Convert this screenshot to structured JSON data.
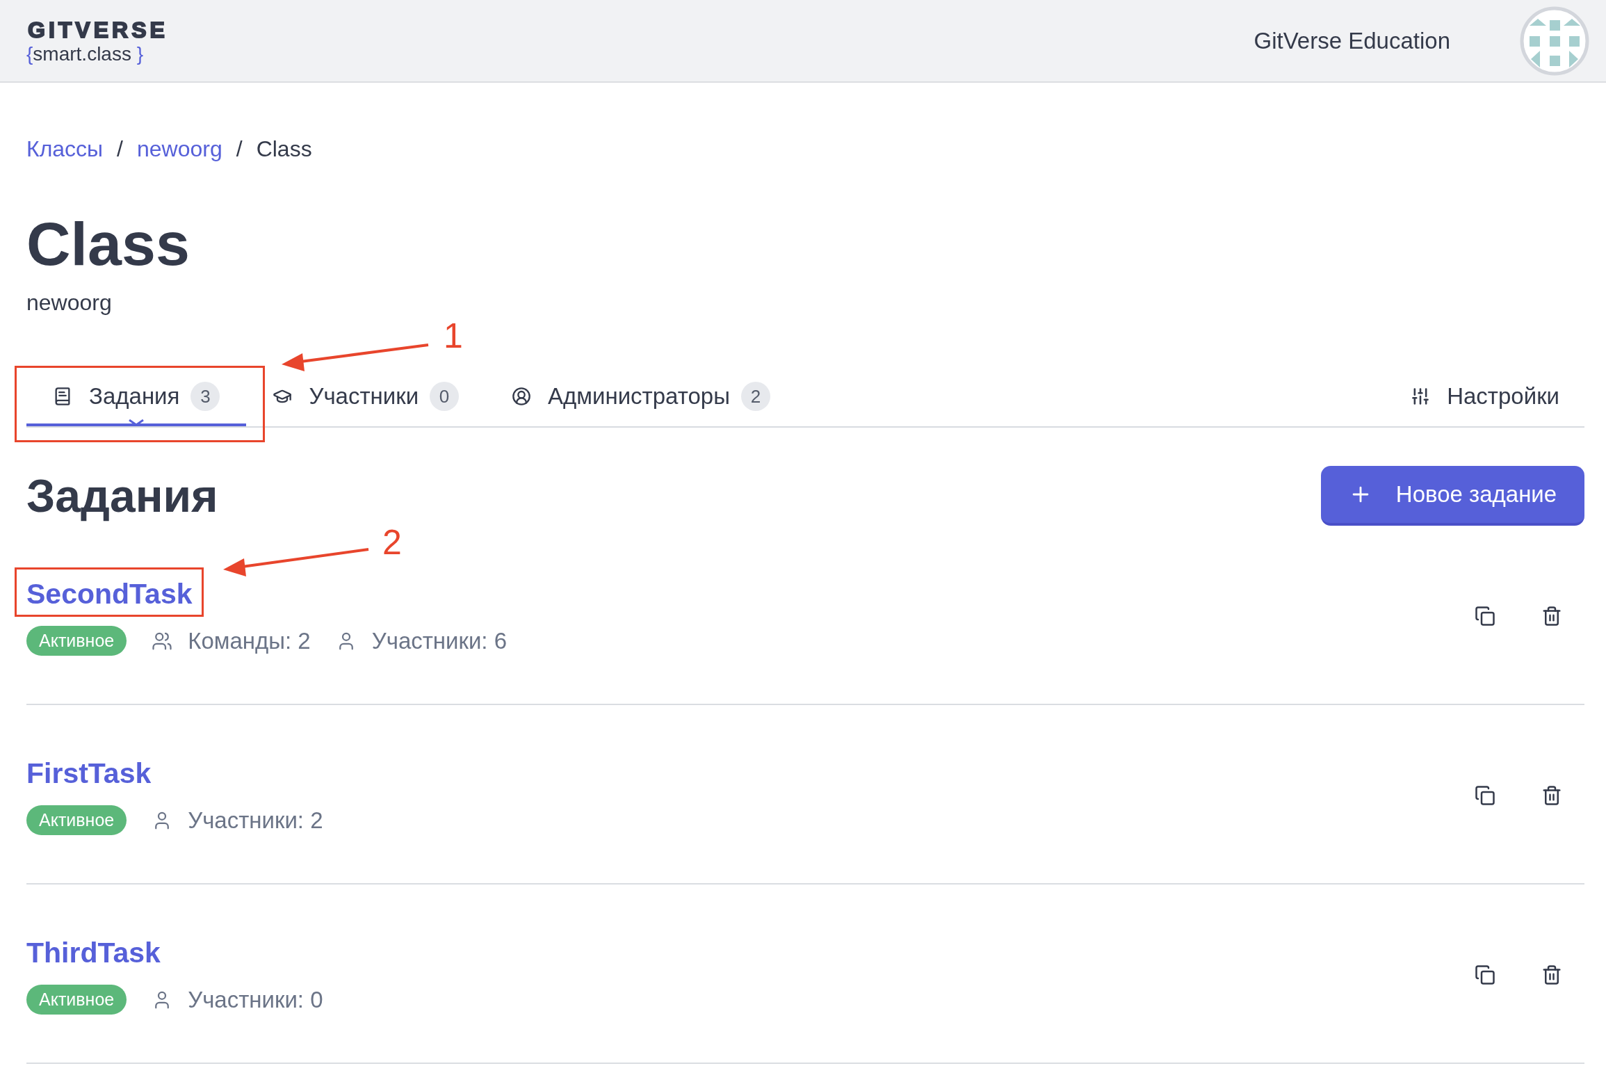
{
  "header": {
    "logo": {
      "wordmark": "GITVERSE",
      "brace_open": "{",
      "tagline": "smart.class",
      "brace_close": "}"
    },
    "org_name": "GitVerse Education"
  },
  "breadcrumbs": [
    {
      "label": "Классы",
      "link": true
    },
    {
      "label": "newoorg",
      "link": true
    },
    {
      "label": "Class",
      "link": false
    }
  ],
  "breadcrumb_separator": "/",
  "page": {
    "title": "Class",
    "subtitle": "newoorg"
  },
  "tabs": [
    {
      "kind": "tasks",
      "label": "Задания",
      "count": "3",
      "selected": true
    },
    {
      "kind": "members",
      "label": "Участники",
      "count": "0",
      "selected": false
    },
    {
      "kind": "admins",
      "label": "Администраторы",
      "count": "2",
      "selected": false
    }
  ],
  "settings_tab": {
    "label": "Настройки",
    "selected": false
  },
  "section": {
    "title": "Задания",
    "new_button": "Новое задание"
  },
  "tasks": [
    {
      "title": "SecondTask",
      "status": "Активное",
      "meta": [
        {
          "kind": "teams",
          "text": "Команды: 2"
        },
        {
          "kind": "members",
          "text": "Участники: 6"
        }
      ]
    },
    {
      "title": "FirstTask",
      "status": "Активное",
      "meta": [
        {
          "kind": "members",
          "text": "Участники: 2"
        }
      ]
    },
    {
      "title": "ThirdTask",
      "status": "Активное",
      "meta": [
        {
          "kind": "members",
          "text": "Участники: 0"
        }
      ]
    }
  ],
  "annotations": [
    {
      "label": "1"
    },
    {
      "label": "2"
    }
  ]
}
